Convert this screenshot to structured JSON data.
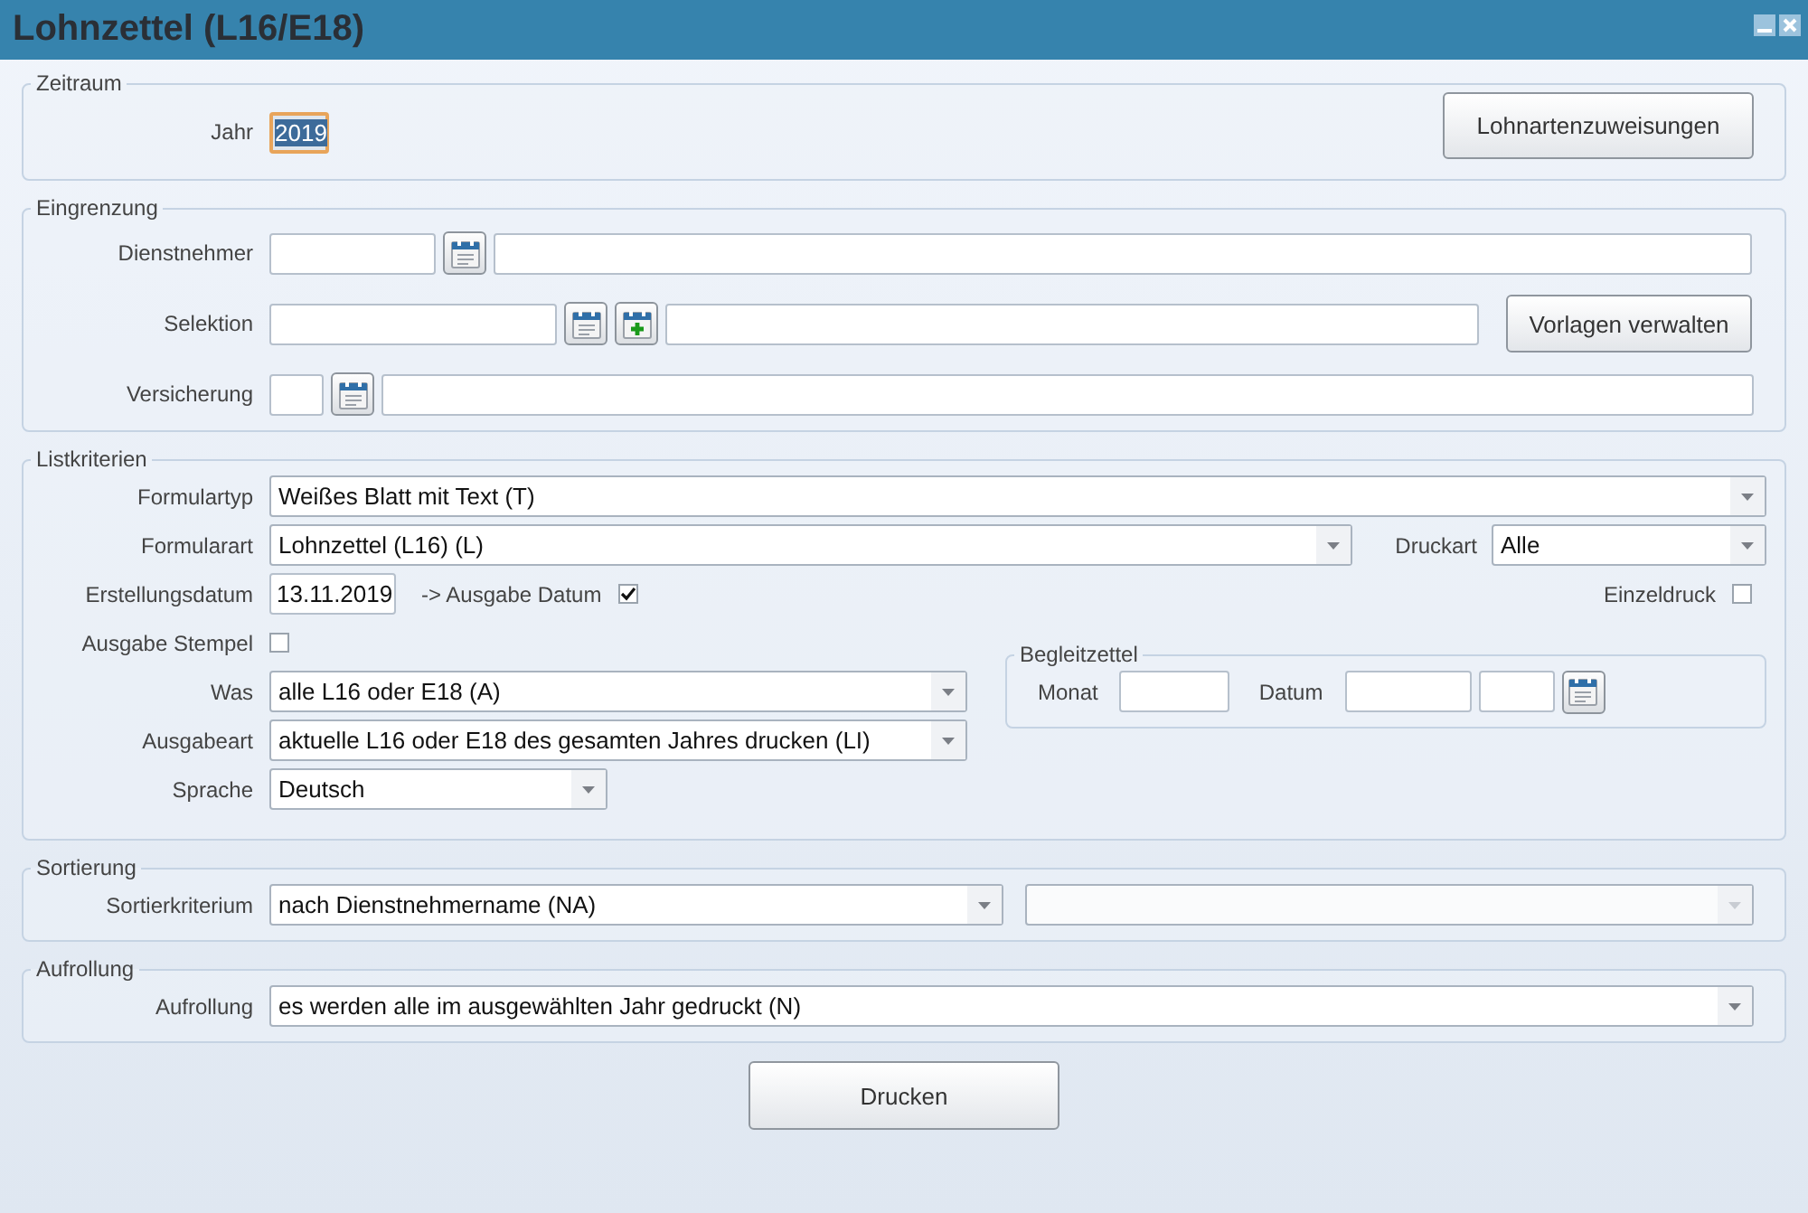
{
  "window": {
    "title": "Lohnzettel (L16/E18)"
  },
  "zeitraum": {
    "legend": "Zeitraum",
    "year_label": "Jahr",
    "year": {
      "value": "2019",
      "focused": true
    },
    "button": "Lohnartenzuweisungen"
  },
  "eingrenzung": {
    "legend": "Eingrenzung",
    "dienstnehmer_label": "Dienstnehmer",
    "selektion_label": "Selektion",
    "vorlagen_button": "Vorlagen verwalten",
    "versicherung_label": "Versicherung"
  },
  "listkriterien": {
    "legend": "Listkriterien",
    "formulartyp": {
      "label": "Formulartyp",
      "value": "Weißes Blatt mit Text (T)"
    },
    "formularart": {
      "label": "Formularart",
      "value": "Lohnzettel (L16) (L)"
    },
    "druckart": {
      "label": "Druckart",
      "value": "Alle"
    },
    "erstellungsdatum": {
      "label": "Erstellungsdatum",
      "value": "13.11.2019"
    },
    "ausgabe_datum": {
      "label": "-> Ausgabe Datum",
      "checked": true
    },
    "einzeldruck": {
      "label": "Einzeldruck",
      "checked": false
    },
    "ausgabe_stempel": {
      "label": "Ausgabe Stempel",
      "checked": false
    },
    "was": {
      "label": "Was",
      "value": "alle L16 oder E18 (A)"
    },
    "ausgabeart": {
      "label": "Ausgabeart",
      "value": "aktuelle L16 oder E18 des gesamten Jahres drucken (LI)"
    },
    "sprache": {
      "label": "Sprache",
      "value": "Deutsch"
    },
    "begleitzettel": {
      "legend": "Begleitzettel",
      "monat_label": "Monat",
      "datum_label": "Datum"
    }
  },
  "sortierung": {
    "legend": "Sortierung",
    "label": "Sortierkriterium",
    "value": "nach Dienstnehmername (NA)",
    "secondary": {
      "disabled": true
    }
  },
  "aufrollung": {
    "legend": "Aufrollung",
    "label": "Aufrollung",
    "value": "es werden alle im ausgewählten Jahr gedruckt (N)"
  },
  "print_button": "Drucken"
}
